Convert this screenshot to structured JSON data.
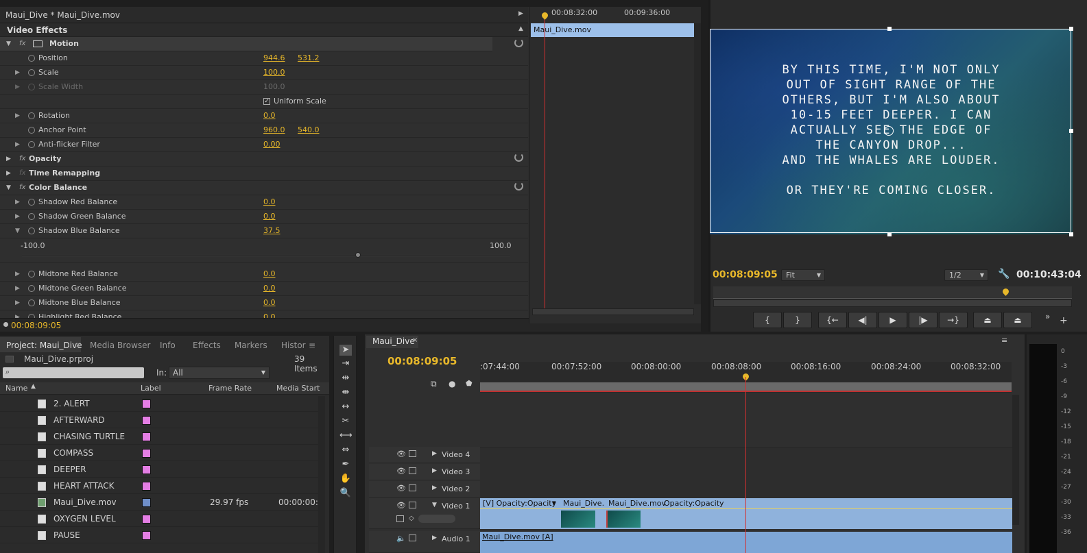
{
  "effect_controls": {
    "header": "Maui_Dive * Maui_Dive.mov",
    "section": "Video Effects",
    "clip_name": "Maui_Dive.mov",
    "ruler": [
      "00:08:32:00",
      "00:09:36:00"
    ],
    "motion": {
      "name": "Motion",
      "fx": "fx"
    },
    "rows": [
      {
        "name": "Position",
        "v1": "944.6",
        "v2": "531.2"
      },
      {
        "name": "Scale",
        "v1": "100.0"
      },
      {
        "name": "Scale Width",
        "v1": "100.0"
      },
      {
        "name": "Uniform Scale"
      },
      {
        "name": "Rotation",
        "v1": "0.0"
      },
      {
        "name": "Anchor Point",
        "v1": "960.0",
        "v2": "540.0"
      },
      {
        "name": "Anti-flicker Filter",
        "v1": "0.00"
      }
    ],
    "opacity": "Opacity",
    "time_remap": "Time Remapping",
    "color_balance": "Color Balance",
    "cb_rows": [
      {
        "name": "Shadow Red Balance",
        "v1": "0.0"
      },
      {
        "name": "Shadow Green Balance",
        "v1": "0.0"
      },
      {
        "name": "Shadow Blue Balance",
        "v1": "37.5"
      }
    ],
    "slider_min": "-100.0",
    "slider_max": "100.0",
    "slider_value": 37.5,
    "cb_rows2": [
      {
        "name": "Midtone Red Balance",
        "v1": "0.0"
      },
      {
        "name": "Midtone Green Balance",
        "v1": "0.0"
      },
      {
        "name": "Midtone Blue Balance",
        "v1": "0.0"
      },
      {
        "name": "Highlight Red Balance",
        "v1": "0.0"
      }
    ],
    "timecode": "00:08:09:05"
  },
  "program": {
    "caption": [
      "BY THIS TIME, I'M NOT ONLY",
      "OUT OF SIGHT RANGE OF THE",
      "OTHERS, BUT I'M ALSO ABOUT",
      "10-15 FEET DEEPER. I CAN",
      "ACTUALLY SEE THE EDGE OF",
      "THE CANYON DROP...",
      "AND THE WHALES ARE LOUDER.",
      "OR THEY'RE COMING CLOSER."
    ],
    "timecode": "00:08:09:05",
    "fit": "Fit",
    "resolution": "1/2",
    "duration": "00:10:43:04"
  },
  "project": {
    "tabs": [
      "Project: Maui_Dive",
      "Media Browser",
      "Info",
      "Effects",
      "Markers",
      "Histor"
    ],
    "file": "Maui_Dive.prproj",
    "count": "39 Items",
    "in_label": "In:",
    "in_value": "All",
    "columns": [
      "Name",
      "Label",
      "Frame Rate",
      "Media Start"
    ],
    "items": [
      {
        "name": "2. ALERT",
        "color": "#e47ee4",
        "fps": "",
        "start": ""
      },
      {
        "name": "AFTERWARD",
        "color": "#e47ee4",
        "fps": "",
        "start": ""
      },
      {
        "name": "CHASING TURTLE",
        "color": "#e47ee4",
        "fps": "",
        "start": ""
      },
      {
        "name": "COMPASS",
        "color": "#e47ee4",
        "fps": "",
        "start": ""
      },
      {
        "name": "DEEPER",
        "color": "#e47ee4",
        "fps": "",
        "start": ""
      },
      {
        "name": "HEART ATTACK",
        "color": "#e47ee4",
        "fps": "",
        "start": ""
      },
      {
        "name": "Maui_Dive.mov",
        "color": "#6f8fc9",
        "fps": "29.97 fps",
        "start": "00:00:00:0"
      },
      {
        "name": "OXYGEN LEVEL",
        "color": "#e47ee4",
        "fps": "",
        "start": ""
      },
      {
        "name": "PAUSE",
        "color": "#e47ee4",
        "fps": "",
        "start": ""
      }
    ]
  },
  "timeline": {
    "tab": "Maui_Dive",
    "timecode": "00:08:09:05",
    "ruler": [
      ":07:44:00",
      "00:07:52:00",
      "00:08:00:00",
      "00:08:08:00",
      "00:08:16:00",
      "00:08:24:00",
      "00:08:32:00"
    ],
    "tracks": [
      "Video 4",
      "Video 3",
      "Video 2",
      "Video 1",
      "Audio 1"
    ],
    "clips": {
      "v1a": "[V]  Opacity:Opacity",
      "v1b": "Maui_Dive.",
      "v1c": "Maui_Dive.mov",
      "v1c_fx": "Opacity:Opacity",
      "a1": "Maui_Dive.mov [A]"
    }
  },
  "meter": {
    "labels": [
      "0",
      "-3",
      "-6",
      "-9",
      "-12",
      "-15",
      "-18",
      "-21",
      "-24",
      "-27",
      "-30",
      "-33",
      "-36"
    ]
  }
}
